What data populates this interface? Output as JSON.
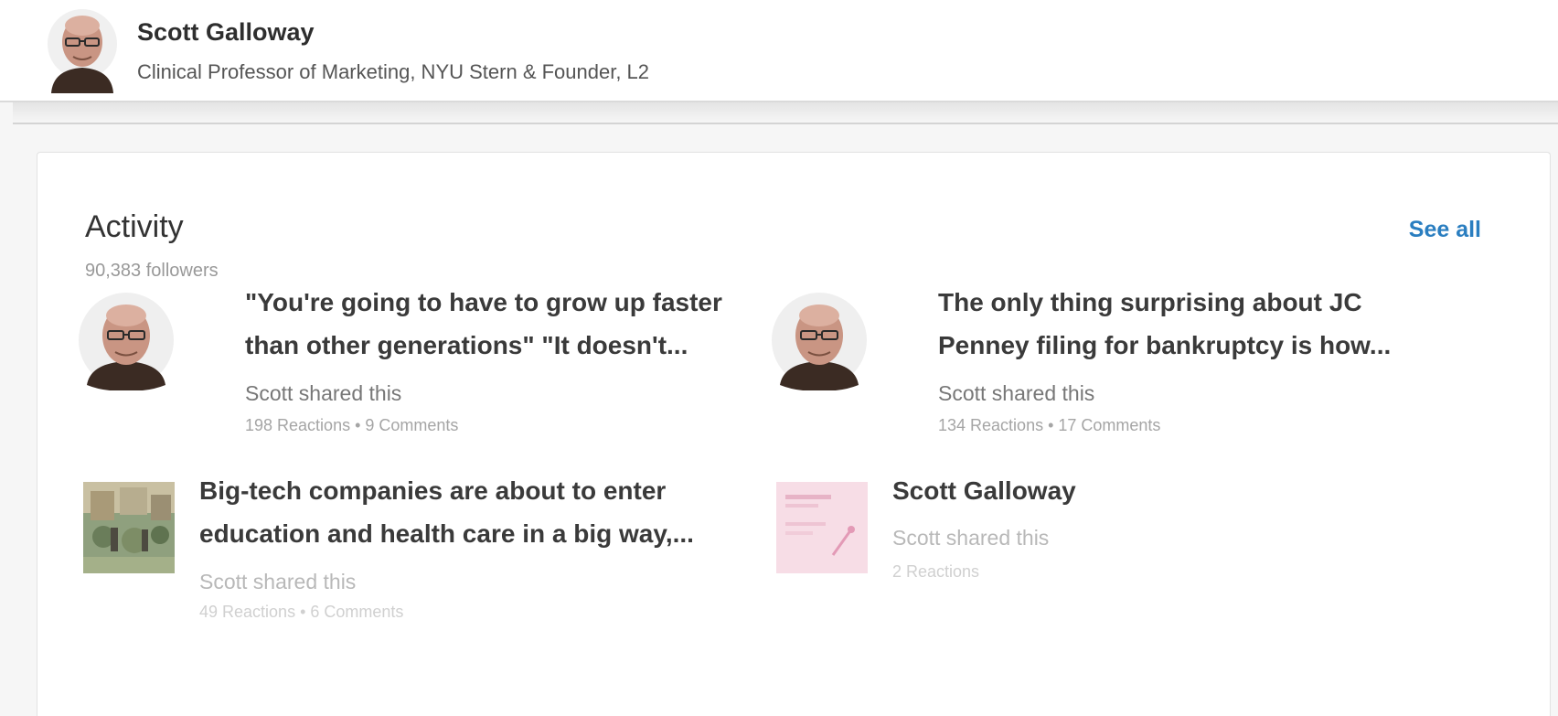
{
  "profile": {
    "name": "Scott Galloway",
    "headline": "Clinical Professor of Marketing, NYU Stern & Founder, L2"
  },
  "activity": {
    "title": "Activity",
    "followers": "90,383 followers",
    "see_all": "See all",
    "posts": [
      {
        "title_line1": "\"You're going to have to grow up faster",
        "title_line2": "than other generations\" \"It doesn't...",
        "shared": "Scott shared this",
        "stats": "198 Reactions • 9 Comments",
        "thumb": "avatar"
      },
      {
        "title_line1": "The only thing surprising about JC",
        "title_line2": "Penney filing for bankruptcy is how...",
        "shared": "Scott shared this",
        "stats": "134 Reactions • 17 Comments",
        "thumb": "avatar"
      },
      {
        "title_line1": "Big-tech companies are about to enter",
        "title_line2": "education and health care in a big way,...",
        "shared": "Scott shared this",
        "stats": "49 Reactions • 6 Comments",
        "thumb": "article-image"
      },
      {
        "title_line1": "Scott Galloway",
        "shared": "Scott shared this",
        "stats": "2 Reactions",
        "thumb": "document-image"
      }
    ]
  },
  "colors": {
    "link": "#2a7ec0",
    "card_bg": "#ffffff",
    "page_bg": "#f6f6f6"
  }
}
